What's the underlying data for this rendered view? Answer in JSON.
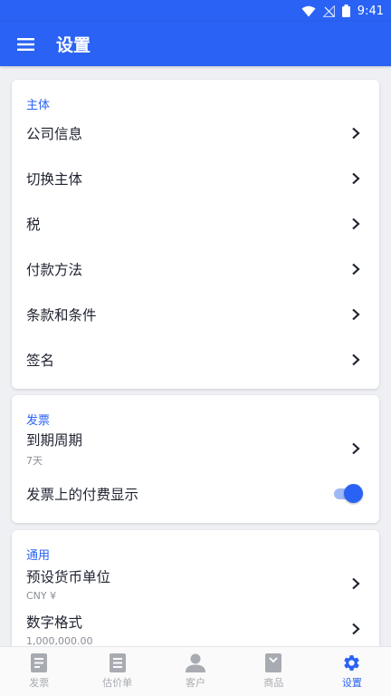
{
  "status_bar": {
    "time": "9:41"
  },
  "app_bar": {
    "title": "设置",
    "menu_icon": "hamburger-menu-icon"
  },
  "sections": {
    "main": {
      "title": "主体",
      "items": [
        "公司信息",
        "切换主体",
        "税",
        "付款方法",
        "条款和条件",
        "签名"
      ]
    },
    "invoice": {
      "title": "发票",
      "due": {
        "label": "到期周期",
        "value": "7天"
      },
      "show_paid": {
        "label": "发票上的付费显示",
        "enabled": true
      }
    },
    "general": {
      "title": "通用",
      "currency": {
        "label": "预设货币单位",
        "value": "CNY ¥"
      },
      "number_format": {
        "label": "数字格式",
        "value": "1,000,000.00"
      }
    }
  },
  "bottom_nav": [
    {
      "label": "发票",
      "icon": "invoice-icon"
    },
    {
      "label": "估价单",
      "icon": "estimate-icon"
    },
    {
      "label": "客户",
      "icon": "customer-icon"
    },
    {
      "label": "商品",
      "icon": "product-icon"
    },
    {
      "label": "设置",
      "icon": "gear-icon",
      "active": true
    }
  ],
  "colors": {
    "primary": "#2962f4",
    "background": "#eef0f4",
    "inactive": "#a8abb1"
  }
}
